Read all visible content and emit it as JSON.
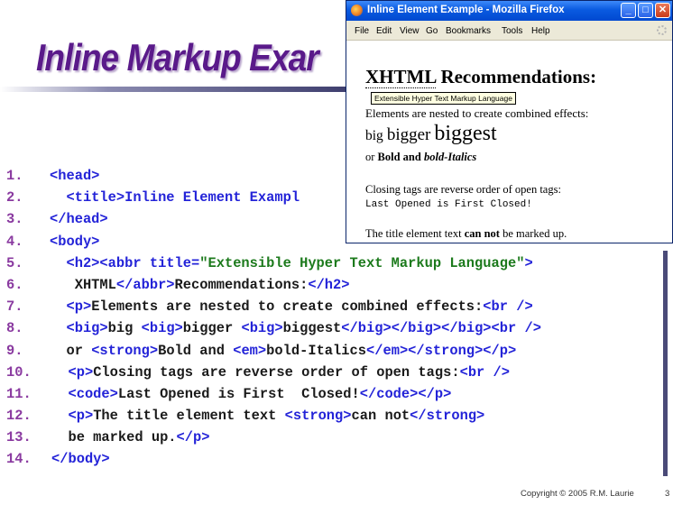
{
  "slide": {
    "title": "Inline Markup Exar",
    "copyright": "Copyright © 2005  R.M. Laurie",
    "page_number": "3",
    "code_lines": [
      {
        "num": "1.",
        "parts": [
          {
            "t": "tag",
            "s": "<head>"
          }
        ]
      },
      {
        "num": "2.",
        "parts": [
          {
            "t": "tag",
            "s": "  <title>Inline Element Exampl"
          }
        ]
      },
      {
        "num": "3.",
        "parts": [
          {
            "t": "tag",
            "s": "</head>"
          }
        ]
      },
      {
        "num": "4.",
        "parts": [
          {
            "t": "tag",
            "s": "<body>"
          }
        ]
      },
      {
        "num": "5.",
        "parts": [
          {
            "t": "tag",
            "s": "  <h2><abbr title="
          },
          {
            "t": "val",
            "s": "\"Extensible Hyper Text Markup Language\""
          },
          {
            "t": "tag",
            "s": ">"
          }
        ]
      },
      {
        "num": "6.",
        "parts": [
          {
            "t": "txt",
            "s": "   XHTML"
          },
          {
            "t": "tag",
            "s": "</abbr>"
          },
          {
            "t": "txt",
            "s": "Recommendations:"
          },
          {
            "t": "tag",
            "s": "</h2>"
          }
        ]
      },
      {
        "num": "7.",
        "parts": [
          {
            "t": "tag",
            "s": "  <p>"
          },
          {
            "t": "txt",
            "s": "Elements are nested to create combined effects:"
          },
          {
            "t": "tag",
            "s": "<br />"
          }
        ]
      },
      {
        "num": "8.",
        "parts": [
          {
            "t": "tag",
            "s": "  <big>"
          },
          {
            "t": "txt",
            "s": "big "
          },
          {
            "t": "tag",
            "s": "<big>"
          },
          {
            "t": "txt",
            "s": "bigger "
          },
          {
            "t": "tag",
            "s": "<big>"
          },
          {
            "t": "txt",
            "s": "biggest"
          },
          {
            "t": "tag",
            "s": "</big></big></big><br />"
          }
        ]
      },
      {
        "num": "9.",
        "parts": [
          {
            "t": "txt",
            "s": "  or "
          },
          {
            "t": "tag",
            "s": "<strong>"
          },
          {
            "t": "txt",
            "s": "Bold and "
          },
          {
            "t": "tag",
            "s": "<em>"
          },
          {
            "t": "txt",
            "s": "bold-Italics"
          },
          {
            "t": "tag",
            "s": "</em></strong></p>"
          }
        ]
      },
      {
        "num": "10.",
        "parts": [
          {
            "t": "tag",
            "s": "  <p>"
          },
          {
            "t": "txt",
            "s": "Closing tags are reverse order of open tags:"
          },
          {
            "t": "tag",
            "s": "<br />"
          }
        ]
      },
      {
        "num": "11.",
        "parts": [
          {
            "t": "tag",
            "s": "  <code>"
          },
          {
            "t": "txt",
            "s": "Last Opened is First  Closed!"
          },
          {
            "t": "tag",
            "s": "</code></p>"
          }
        ]
      },
      {
        "num": "12.",
        "parts": [
          {
            "t": "tag",
            "s": "  <p>"
          },
          {
            "t": "txt",
            "s": "The title element text "
          },
          {
            "t": "tag",
            "s": "<strong>"
          },
          {
            "t": "txt",
            "s": "can not"
          },
          {
            "t": "tag",
            "s": "</strong>"
          }
        ]
      },
      {
        "num": "13.",
        "parts": [
          {
            "t": "txt",
            "s": "  be marked up."
          },
          {
            "t": "tag",
            "s": "</p>"
          }
        ]
      },
      {
        "num": "14.",
        "parts": [
          {
            "t": "tag",
            "s": "</body>"
          }
        ]
      }
    ],
    "colors": {
      "title": "#5a1a8a",
      "tag": "#2323d8",
      "value": "#1c7a1c",
      "line_number": "#8a3aa0"
    }
  },
  "browser": {
    "title": "Inline Element Example - Mozilla Firefox",
    "menu": [
      "File",
      "Edit",
      "View",
      "Go",
      "Bookmarks",
      "Tools",
      "Help"
    ],
    "window_buttons": {
      "minimize": "_",
      "maximize": "□",
      "close": "✕"
    },
    "content": {
      "heading_abbr": "XHTML",
      "heading_rest": " Recommendations:",
      "tooltip": "Extensible Hyper Text Markup Language",
      "p1_line1": "Elements are nested to create combined effects:",
      "big": "big",
      "bigger": "bigger",
      "biggest": "biggest",
      "or": "or ",
      "bold": "Bold and ",
      "bold_italics": "bold-Italics",
      "p2_line1": "Closing tags are reverse order of open tags:",
      "p2_code": "Last Opened is First Closed!",
      "p3_before": "The title element text ",
      "p3_strong": "can not",
      "p3_after": " be marked up."
    }
  }
}
